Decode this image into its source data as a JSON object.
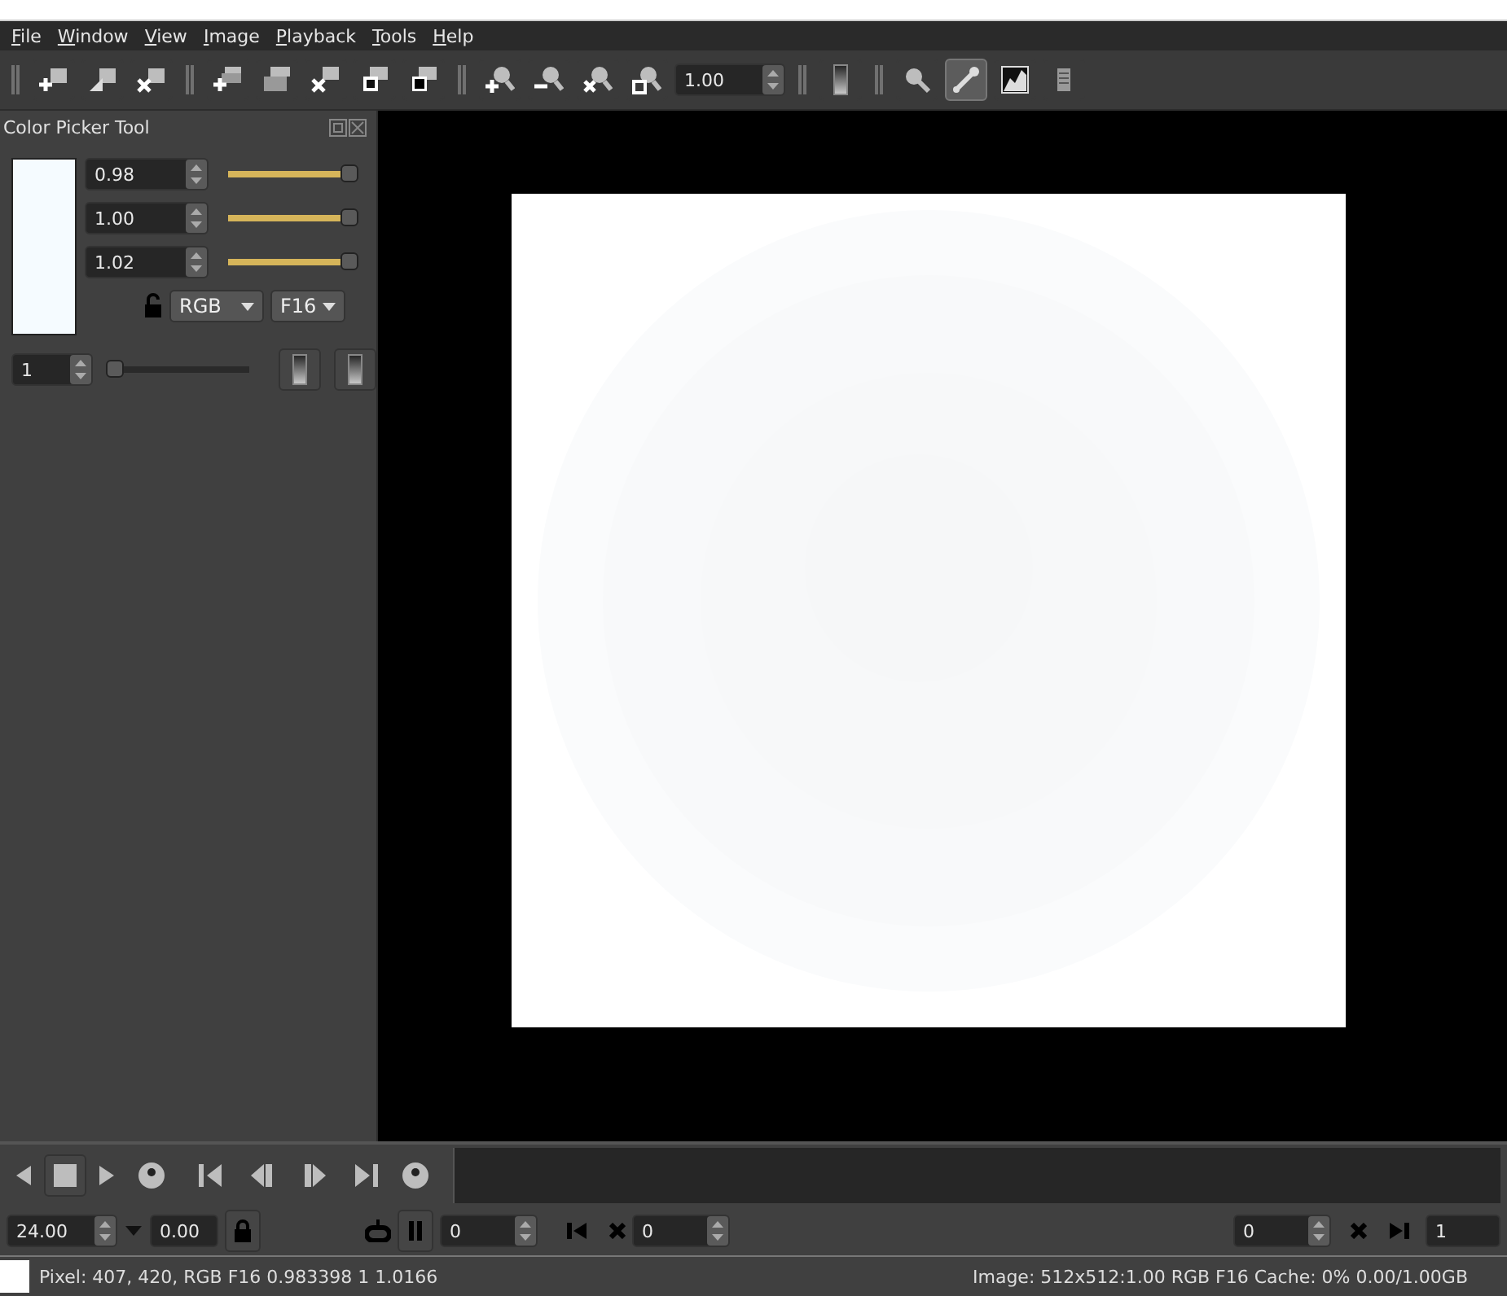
{
  "menu": [
    "File",
    "Window",
    "View",
    "Image",
    "Playback",
    "Tools",
    "Help"
  ],
  "toolbar": {
    "zoom": "1.00",
    "tools": [
      {
        "selected": false
      },
      {
        "selected": true
      },
      {
        "selected": false
      },
      {
        "selected": false
      }
    ]
  },
  "color_picker": {
    "title": "Color Picker Tool",
    "channels": [
      {
        "value": "0.98",
        "level": 1
      },
      {
        "value": "1.00",
        "level": 1
      },
      {
        "value": "1.02",
        "level": 1
      }
    ],
    "locked": false,
    "format": "RGB",
    "type": "F16",
    "average": "1",
    "average_slider": {
      "level": 0
    }
  },
  "playback": {
    "speed": "24.00",
    "actual_speed": "0.00",
    "start": "0",
    "current": "0",
    "in_point": "0",
    "end": "1"
  },
  "status_bar": {
    "pixel": "Pixel: 407, 420, RGB F16 0.983398 1 1.0166",
    "image": "Image: 512x512:1.00 RGB F16  Cache: 0% 0.00/1.00GB"
  }
}
